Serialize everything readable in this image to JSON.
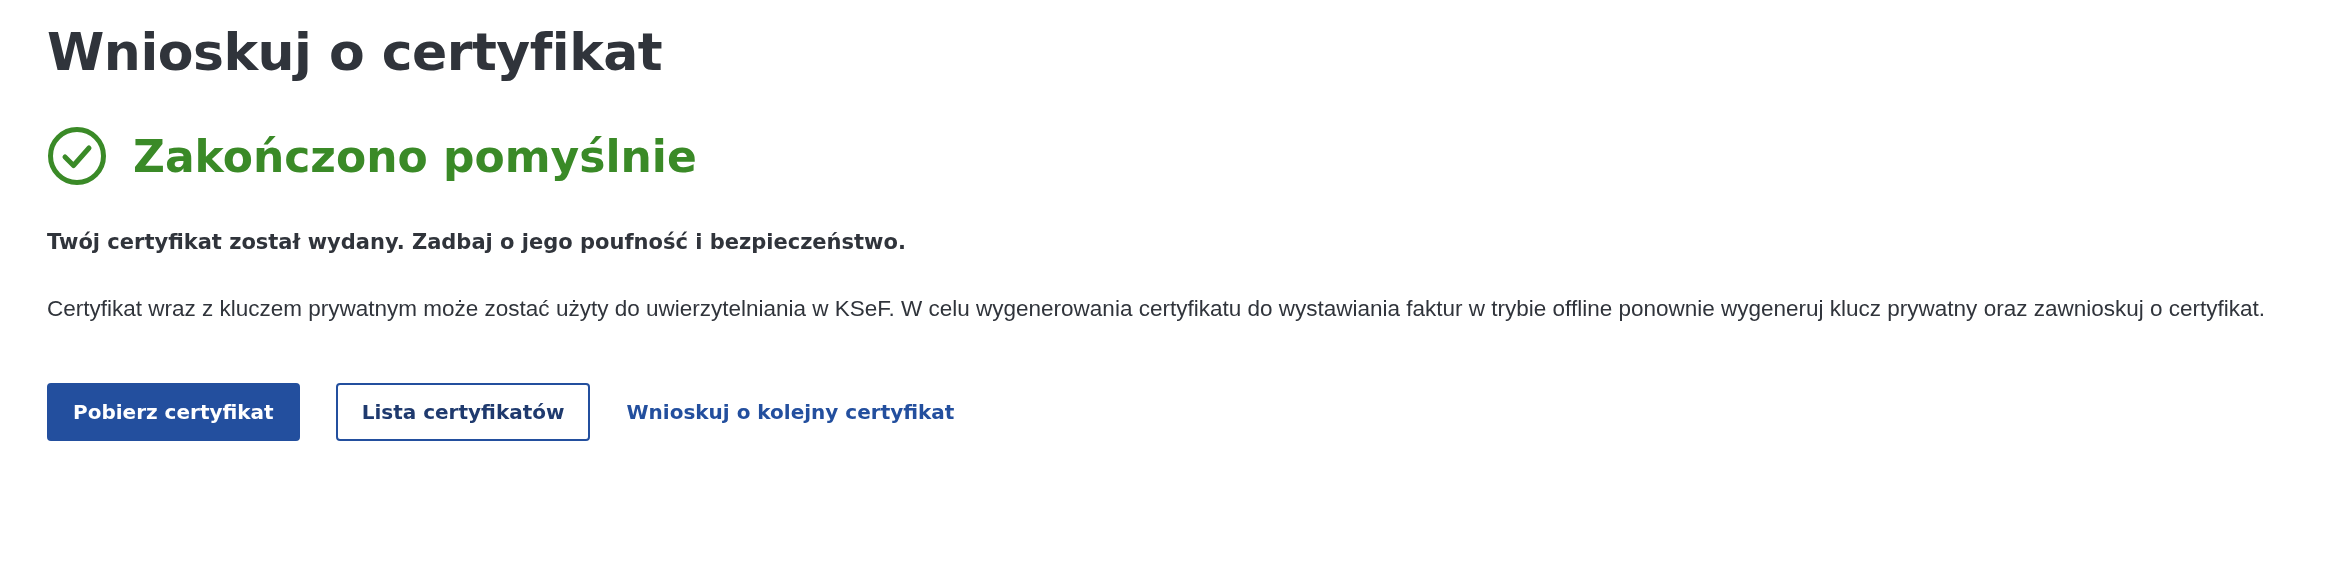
{
  "title": "Wnioskuj o certyfikat",
  "status": {
    "kind": "success",
    "label": "Zakończono pomyślnie"
  },
  "lead": "Twój certyfikat został wydany. Zadbaj o jego poufność i bezpieczeństwo.",
  "description": "Certyfikat wraz z kluczem prywatnym może zostać użyty do uwierzytelniania w KSeF. W celu wygenerowania certyfikatu do wystawiania faktur w trybie offline ponownie wygeneruj klucz prywatny oraz zawnioskuj o certyfikat.",
  "actions": [
    {
      "kind": "primary",
      "label": "Pobierz certyfikat"
    },
    {
      "kind": "secondary",
      "label": "Lista certyfikatów"
    },
    {
      "kind": "link",
      "label": "Wnioskuj o kolejny certyfikat"
    }
  ]
}
